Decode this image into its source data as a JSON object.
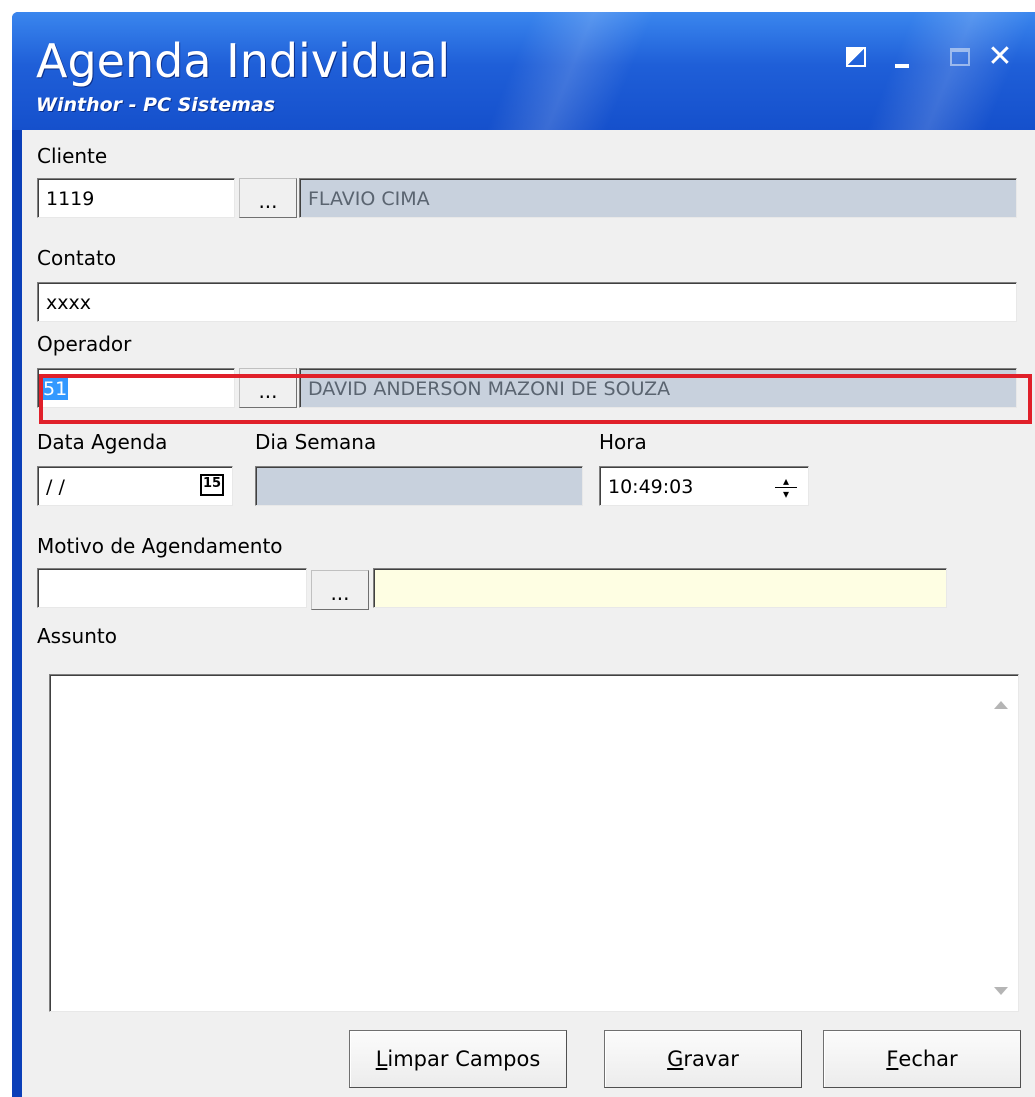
{
  "window": {
    "title": "Agenda Individual",
    "subtitle": "Winthor - PC Sistemas",
    "close_glyph": "✕"
  },
  "cliente": {
    "label": "Cliente",
    "code": "1119",
    "lookup": "...",
    "name": "FLAVIO CIMA"
  },
  "contato": {
    "label": "Contato",
    "value": "xxxx"
  },
  "operador": {
    "label": "Operador",
    "code": "51",
    "lookup": "...",
    "name": "DAVID ANDERSON MAZONI DE SOUZA"
  },
  "data_agenda": {
    "label": "Data Agenda",
    "value": " / /",
    "calendar_glyph": "15"
  },
  "dia_semana": {
    "label": "Dia Semana",
    "value": ""
  },
  "hora": {
    "label": "Hora",
    "value": "10:49:03"
  },
  "motivo": {
    "label": "Motivo de Agendamento",
    "code": "",
    "lookup": "...",
    "description": ""
  },
  "assunto": {
    "label": "Assunto",
    "value": ""
  },
  "buttons": {
    "limpar": {
      "mnemonic": "L",
      "rest": "impar Campos"
    },
    "gravar": {
      "mnemonic": "G",
      "rest": "ravar"
    },
    "fechar": {
      "mnemonic": "F",
      "rest": "echar"
    }
  },
  "colors": {
    "title_bar": "#1f5fd8",
    "highlight": "#e0202a",
    "readonly_field": "#c8d1dd",
    "selection": "#3399ff",
    "required_field": "#fefee3"
  }
}
